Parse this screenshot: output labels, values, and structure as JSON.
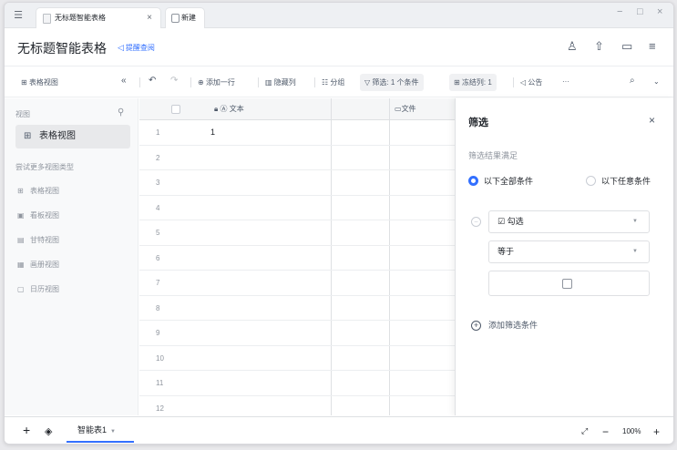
{
  "titlebar": {
    "app_icon": "app-menu-icon",
    "active_tab_title": "无标题智能表格",
    "active_tab_close": "×",
    "new_tab_label": "新建",
    "window_controls": [
      "−",
      "□",
      "×"
    ]
  },
  "header": {
    "doc_title": "无标题智能表格",
    "remind_label": "提醒查阅",
    "icons": [
      "add-collaborator-icon",
      "share-icon",
      "comment-icon",
      "menu-icon"
    ]
  },
  "toolbar": {
    "view_name": "表格视图",
    "collapse": "«",
    "undo": "↶",
    "redo": "↷",
    "add_row": "添加一行",
    "hide_col": "隐藏列",
    "group": "分组",
    "filter": "筛选: 1 个条件",
    "freeze": "冻结列: 1",
    "notice": "公告",
    "more": "···",
    "search": "search-icon",
    "expand": "chevron-down-icon"
  },
  "sidebar": {
    "header": "视图",
    "active_view": "表格视图",
    "more_types_header": "尝试更多视图类型",
    "view_types": [
      "表格视图",
      "看板视图",
      "甘特视图",
      "画册视图",
      "日历视图"
    ]
  },
  "grid": {
    "columns": [
      "文本",
      "文件"
    ],
    "rows": [
      {
        "n": "1",
        "text": "1"
      },
      {
        "n": "2",
        "text": ""
      },
      {
        "n": "3",
        "text": ""
      },
      {
        "n": "4",
        "text": ""
      },
      {
        "n": "5",
        "text": ""
      },
      {
        "n": "6",
        "text": ""
      },
      {
        "n": "7",
        "text": ""
      },
      {
        "n": "8",
        "text": ""
      },
      {
        "n": "9",
        "text": ""
      },
      {
        "n": "10",
        "text": ""
      },
      {
        "n": "11",
        "text": ""
      },
      {
        "n": "12",
        "text": ""
      }
    ]
  },
  "filter_panel": {
    "title": "筛选",
    "close": "×",
    "subtitle": "筛选结果满足",
    "match_all": "以下全部条件",
    "match_any": "以下任意条件",
    "field": "勾选",
    "operator": "等于",
    "add_condition": "添加筛选条件"
  },
  "footer": {
    "add": "+",
    "layers": "layers-icon",
    "sheet_tab": "智能表1",
    "fit": "fit-screen-icon",
    "zoom_out": "−",
    "zoom": "100%",
    "zoom_in": "+"
  }
}
